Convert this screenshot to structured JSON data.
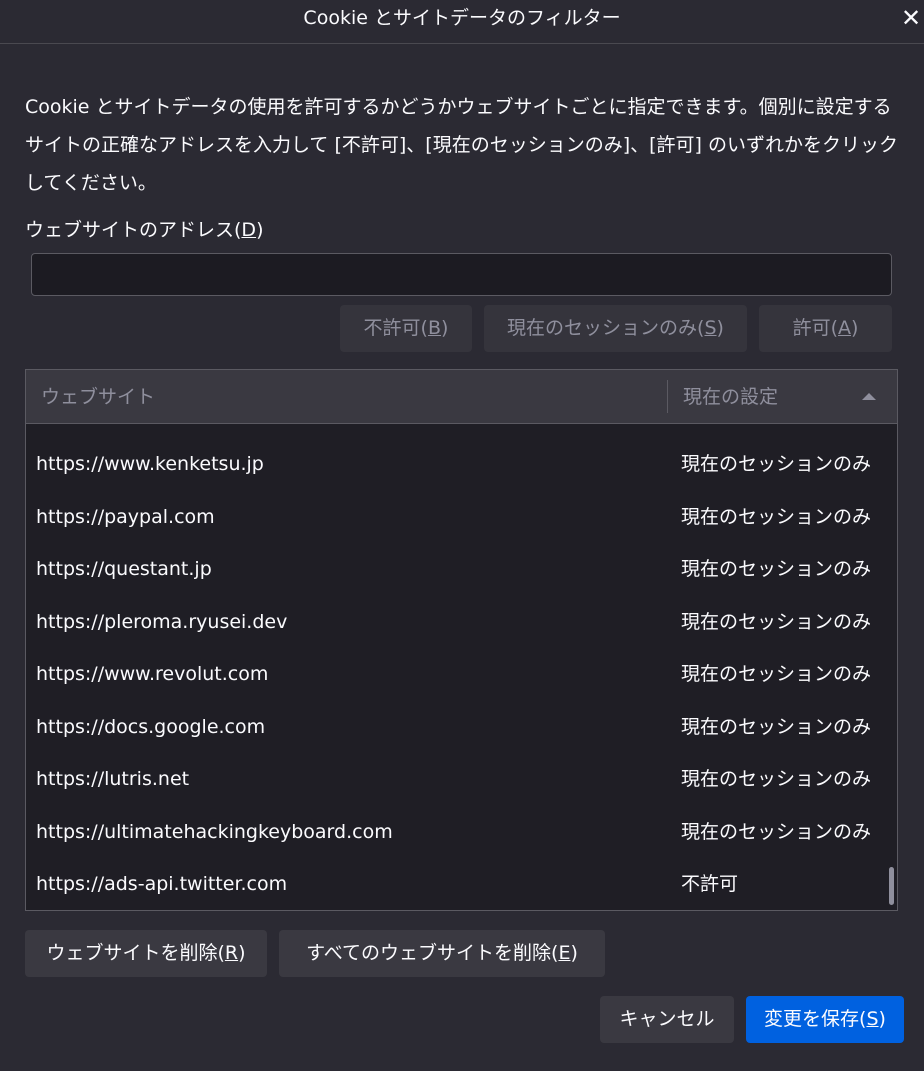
{
  "dialog": {
    "title": "Cookie とサイトデータのフィルター",
    "close_glyph": "✕"
  },
  "description": "Cookie とサイトデータの使用を許可するかどうかウェブサイトごとに指定できます。個別に設定するサイトの正確なアドレスを入力して [不許可]、[現在のセッションのみ]、[許可] のいずれかをクリックしてください。",
  "address": {
    "label": "ウェブサイトのアドレス(",
    "accesskey": "D",
    "label_end": ")",
    "value": "",
    "placeholder": ""
  },
  "action_buttons": {
    "block": {
      "label": "不許可(",
      "accesskey": "B",
      "end": ")"
    },
    "session": {
      "label": "現在のセッションのみ(",
      "accesskey": "S",
      "end": ")"
    },
    "allow": {
      "label": "許可(",
      "accesskey": "A",
      "end": ")"
    }
  },
  "table": {
    "columns": [
      "ウェブサイト",
      "現在の設定"
    ],
    "sort_indicator": "ascending",
    "rows": [
      {
        "site": "https://www.kenketsu.jp",
        "status": "現在のセッションのみ"
      },
      {
        "site": "https://paypal.com",
        "status": "現在のセッションのみ"
      },
      {
        "site": "https://questant.jp",
        "status": "現在のセッションのみ"
      },
      {
        "site": "https://pleroma.ryusei.dev",
        "status": "現在のセッションのみ"
      },
      {
        "site": "https://www.revolut.com",
        "status": "現在のセッションのみ"
      },
      {
        "site": "https://docs.google.com",
        "status": "現在のセッションのみ"
      },
      {
        "site": "https://lutris.net",
        "status": "現在のセッションのみ"
      },
      {
        "site": "https://ultimatehackingkeyboard.com",
        "status": "現在のセッションのみ"
      },
      {
        "site": "https://ads-api.twitter.com",
        "status": "不許可"
      }
    ]
  },
  "remove_buttons": {
    "remove": {
      "label": "ウェブサイトを削除(",
      "accesskey": "R",
      "end": ")"
    },
    "remove_all": {
      "label": "すべてのウェブサイトを削除(",
      "accesskey": "E",
      "end": ")"
    }
  },
  "footer": {
    "cancel": "キャンセル",
    "save": {
      "label": "変更を保存(",
      "accesskey": "S",
      "end": ")"
    }
  },
  "colors": {
    "background": "#2b2a33",
    "primary": "#0061e0",
    "disabled_text": "#8f8f9d"
  }
}
